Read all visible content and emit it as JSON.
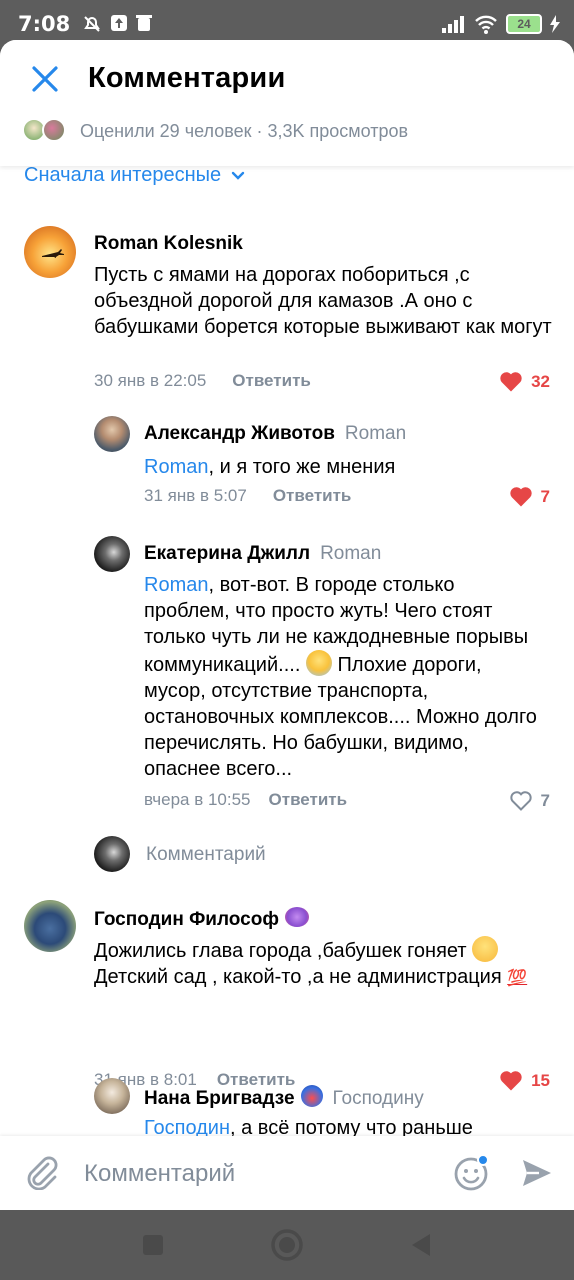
{
  "status_bar": {
    "time": "7:08",
    "battery": "24"
  },
  "header": {
    "title": "Комментарии",
    "stats": "Оценили 29 человек · 3,3K просмотров"
  },
  "sort": {
    "label": "Сначала интересные"
  },
  "comments": [
    {
      "author": "Roman Kolesnik",
      "text": "Пусть с ямами на дорогах побориться ,с объездной дорогой для камазов .А оно с бабушками борется которые выживают как могут",
      "date": "30 янв в 22:05",
      "reply_label": "Ответить",
      "likes": "32"
    },
    {
      "author": "Александр Животов",
      "reply_to": "Roman",
      "mention": "Roman",
      "text": ", и я того же мнения",
      "date": "31 янв в 5:07",
      "reply_label": "Ответить",
      "likes": "7"
    },
    {
      "author": "Екатерина Джилл",
      "reply_to": "Roman",
      "mention": "Roman",
      "text_a": ", вот-вот. В городе столько проблем, что просто жуть! Чего стоят только чуть ли не каждодневные порывы коммуникаций....",
      "text_b": " Плохие дороги, мусор, отсутствие транспорта, остановочных комплексов.... Можно долго перечислять.  Но бабушки, видимо, опаснее всего...",
      "date": "вчера в 10:55",
      "reply_label": "Ответить",
      "likes": "7"
    },
    {
      "author": "Господин Философ",
      "text_a": "Дожились глава города ,бабушек гоняет",
      "text_b": " Детский сад , какой-то ,а не администрация",
      "date": "31 янв в 8:01",
      "reply_label": "Ответить",
      "likes": "15"
    },
    {
      "author": "Нана Бригвадзе",
      "reply_to": "Господину",
      "mention": "Господин",
      "text": ", а всё потому что раньше"
    }
  ],
  "inline_reply": {
    "placeholder": "Комментарий"
  },
  "composer": {
    "placeholder": "Комментарий"
  },
  "colors": {
    "accent": "#2688eb",
    "like_active": "#e64646",
    "secondary_text": "#818c99"
  }
}
